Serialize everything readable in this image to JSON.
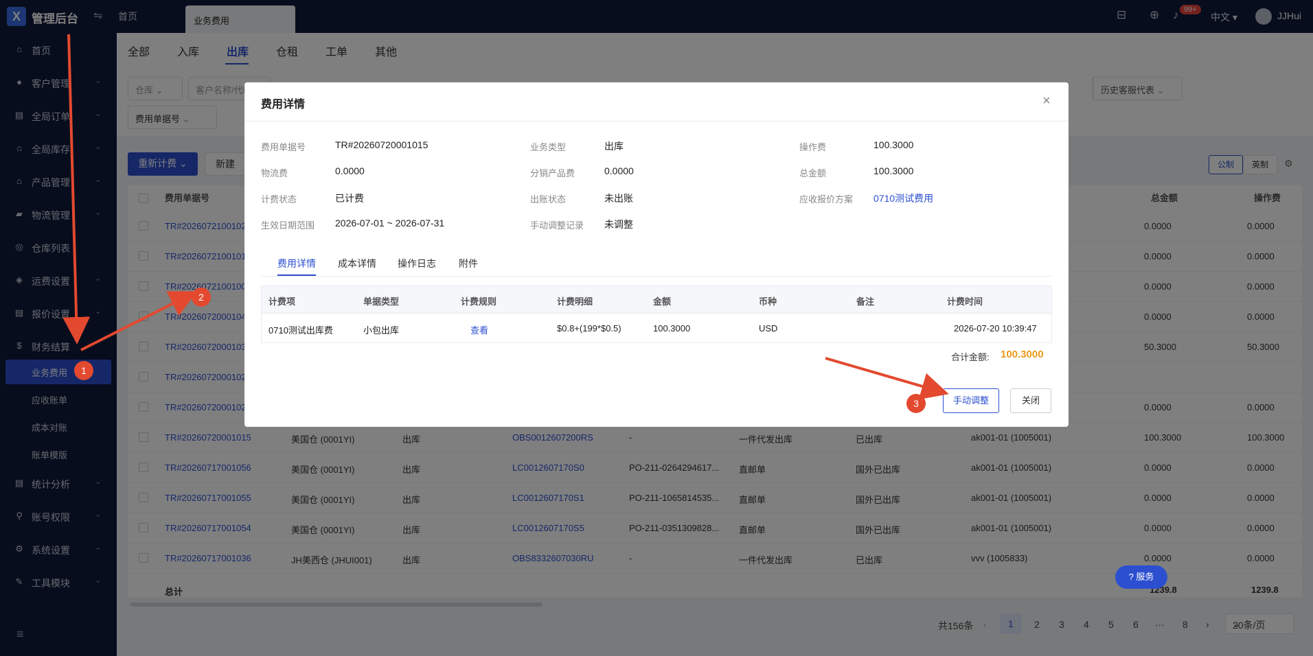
{
  "app": {
    "brand": "管理后台",
    "logo": "X",
    "user": "JJHui",
    "lang": "中文",
    "notif_badge": "99+"
  },
  "tabs": {
    "home": "首页",
    "active": "业务费用"
  },
  "sidebar": {
    "items": [
      {
        "label": "首页",
        "icon": "home-icon"
      },
      {
        "label": "客户管理",
        "icon": "user-icon"
      },
      {
        "label": "全局订单",
        "icon": "order-icon"
      },
      {
        "label": "全局库存",
        "icon": "stock-icon"
      },
      {
        "label": "产品管理",
        "icon": "product-icon"
      },
      {
        "label": "物流管理",
        "icon": "truck-icon"
      },
      {
        "label": "仓库列表",
        "icon": "warehouse-icon"
      },
      {
        "label": "运费设置",
        "icon": "freight-icon"
      },
      {
        "label": "报价设置",
        "icon": "quote-icon"
      },
      {
        "label": "财务结算",
        "icon": "finance-icon"
      },
      {
        "label": "统计分析",
        "icon": "stats-icon"
      },
      {
        "label": "账号权限",
        "icon": "account-icon"
      },
      {
        "label": "系统设置",
        "icon": "settings-icon"
      },
      {
        "label": "工具模块",
        "icon": "tool-icon"
      }
    ],
    "finance_sub": [
      "业务费用",
      "应收账单",
      "成本对账",
      "账单模版"
    ]
  },
  "page_tabs": [
    "全部",
    "入库",
    "出库",
    "仓租",
    "工单",
    "其他"
  ],
  "filters": {
    "warehouse": "仓库",
    "customer": "客户名称/代码",
    "history": "历史客服代表",
    "doc_type": "费用单据号"
  },
  "toolbar": {
    "recalc": "重新计费",
    "new": "新建",
    "metric": "公制",
    "imperial": "英制"
  },
  "table": {
    "headers": {
      "doc": "费用单据号",
      "total": "总金额",
      "op_fee": "操作费"
    },
    "rows": [
      {
        "doc": "TR#20260721001026",
        "total": "0.0000",
        "op": "0.0000"
      },
      {
        "doc": "TR#20260721001015",
        "total": "0.0000",
        "op": "0.0000"
      },
      {
        "doc": "TR#20260721001004",
        "total": "0.0000",
        "op": "0.0000"
      },
      {
        "doc": "TR#20260720001040",
        "total": "0.0000",
        "op": "0.0000"
      },
      {
        "doc": "TR#20260720001035",
        "total": "50.3000",
        "op": "50.3000"
      },
      {
        "doc": "TR#20260720001025",
        "total": "",
        "op": ""
      },
      {
        "doc": "TR#20260720001020",
        "total": "0.0000",
        "op": "0.0000"
      },
      {
        "doc": "TR#20260720001015",
        "wh": "美国仓 (0001YI)",
        "biz": "出库",
        "ref": "OBS0012607200RS",
        "po": "-",
        "mode": "一件代发出库",
        "status": "已出库",
        "cust": "ak001-01 (1005001)",
        "total": "100.3000",
        "op": "100.3000"
      },
      {
        "doc": "TR#20260717001056",
        "wh": "美国仓 (0001YI)",
        "biz": "出库",
        "ref": "LC0012607170S0",
        "po": "PO-211-0264294617...",
        "mode": "直邮单",
        "status": "国外已出库",
        "cust": "ak001-01 (1005001)",
        "total": "0.0000",
        "op": "0.0000"
      },
      {
        "doc": "TR#20260717001055",
        "wh": "美国仓 (0001YI)",
        "biz": "出库",
        "ref": "LC0012607170S1",
        "po": "PO-211-1065814535...",
        "mode": "直邮单",
        "status": "国外已出库",
        "cust": "ak001-01 (1005001)",
        "total": "0.0000",
        "op": "0.0000"
      },
      {
        "doc": "TR#20260717001054",
        "wh": "美国仓 (0001YI)",
        "biz": "出库",
        "ref": "LC0012607170S5",
        "po": "PO-211-0351309828...",
        "mode": "直邮单",
        "status": "国外已出库",
        "cust": "ak001-01 (1005001)",
        "total": "0.0000",
        "op": "0.0000"
      },
      {
        "doc": "TR#20260717001036",
        "wh": "JH美西仓 (JHUI001)",
        "biz": "出库",
        "ref": "OBS8332607030RU",
        "po": "-",
        "mode": "一件代发出库",
        "status": "已出库",
        "cust": "vvv (1005833)",
        "total": "0.0000",
        "op": "0.0000"
      }
    ],
    "sum_label": "总计",
    "sum_total": "1239.8",
    "sum_op": "1239.8"
  },
  "pager": {
    "total": "共156条",
    "pages": [
      "1",
      "2",
      "3",
      "4",
      "5",
      "6",
      "···",
      "8"
    ],
    "size": "20条/页"
  },
  "dialog": {
    "title": "费用详情",
    "fields": {
      "doc_no_k": "费用单据号",
      "doc_no_v": "TR#20260720001015",
      "biz_type_k": "业务类型",
      "biz_type_v": "出库",
      "op_fee_k": "操作费",
      "op_fee_v": "100.3000",
      "logistics_k": "物流费",
      "logistics_v": "0.0000",
      "dist_k": "分销产品费",
      "dist_v": "0.0000",
      "total_k": "总金额",
      "total_v": "100.3000",
      "calc_status_k": "计费状态",
      "calc_status_v": "已计费",
      "bill_status_k": "出账状态",
      "bill_status_v": "未出账",
      "quote_k": "应收报价方案",
      "quote_v": "0710测试费用",
      "date_k": "生效日期范围",
      "date_v": "2026-07-01 ~ 2026-07-31",
      "manual_k": "手动调整记录",
      "manual_v": "未调整"
    },
    "tabs": [
      "费用详情",
      "成本详情",
      "操作日志",
      "附件"
    ],
    "detail_headers": [
      "计费项",
      "单据类型",
      "计费规则",
      "计费明细",
      "金额",
      "币种",
      "备注",
      "计费时间"
    ],
    "detail_row": {
      "item": "0710测试出库费",
      "doc_type": "小包出库",
      "rule": "查看",
      "detail": "$0.8+(199*$0.5)",
      "amount": "100.3000",
      "currency": "USD",
      "note": "",
      "time": "2026-07-20 10:39:47"
    },
    "total_label": "合计金额:",
    "total_value": "100.3000",
    "adjust_btn": "手动调整",
    "close_btn": "关闭"
  },
  "help": {
    "label": "服务"
  },
  "markers": [
    "1",
    "2",
    "3"
  ],
  "colors": {
    "primary": "#2c4fd0",
    "sidebar": "#0e1a3a",
    "marker": "#e3492f",
    "total": "#e99a1c"
  }
}
